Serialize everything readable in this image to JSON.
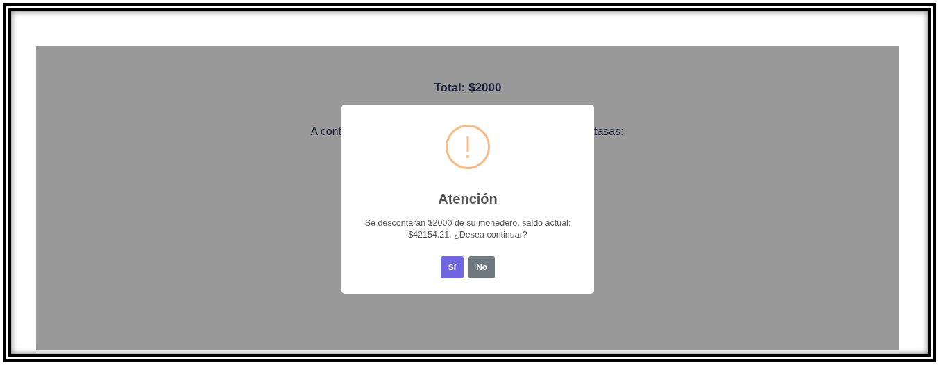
{
  "page": {
    "total": "Total: $2000",
    "partial_line": [
      "A cont",
      "tasas:"
    ]
  },
  "dialog": {
    "title": "Atención",
    "message": "Se descontarán $2000 de su monedero, saldo actual: $42154.21. ¿Desea continuar?",
    "buttons": [
      {
        "label": "Sí",
        "kind": "confirm"
      },
      {
        "label": "No",
        "kind": "cancel"
      }
    ]
  }
}
